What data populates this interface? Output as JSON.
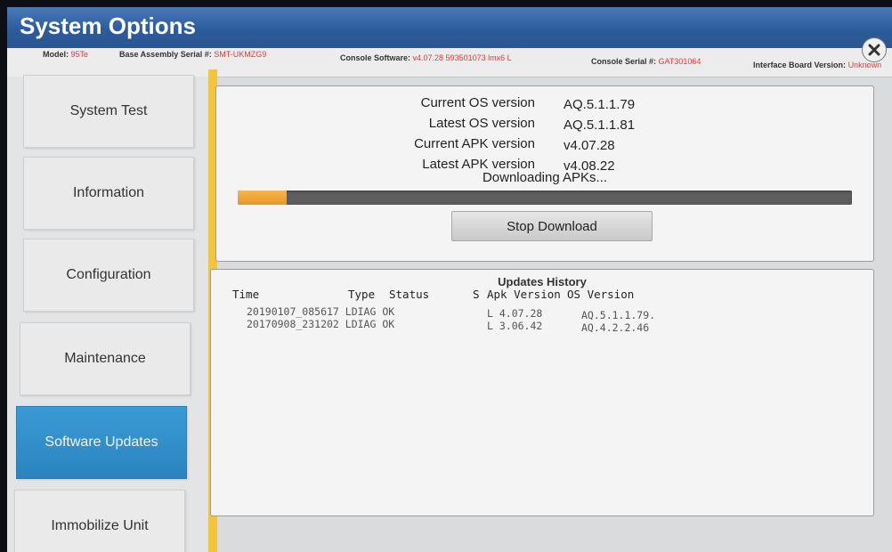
{
  "header": {
    "title": "System Options"
  },
  "info_bar": {
    "model_label": "Model:",
    "model_value": "95Te",
    "base_label": "Base Assembly Serial #:",
    "base_value": "SMT-UKMZG9",
    "console_sw_label": "Console Software:",
    "console_sw_value": "v4.07.28 593501073 lmx6 L",
    "console_serial_label": "Console Serial #:",
    "console_serial_value": "GAT301064",
    "interface_label": "Interface Board Version:",
    "interface_value": "Unknown"
  },
  "sidebar": {
    "items": [
      {
        "label": "System Test"
      },
      {
        "label": "Information"
      },
      {
        "label": "Configuration"
      },
      {
        "label": "Maintenance"
      },
      {
        "label": "Software Updates"
      },
      {
        "label": "Immobilize Unit"
      }
    ],
    "active_index": 4
  },
  "update_panel": {
    "rows": [
      {
        "label": "Current OS version",
        "value": "AQ.5.1.1.79"
      },
      {
        "label": "Latest OS version",
        "value": "AQ.5.1.1.81"
      },
      {
        "label": "Current APK version",
        "value": "v4.07.28"
      },
      {
        "label": "Latest APK version",
        "value": "v4.08.22"
      }
    ],
    "status_text": "Downloading APKs...",
    "progress_fraction": 0.08,
    "stop_button_label": "Stop Download"
  },
  "history": {
    "title": "Updates History",
    "columns": {
      "time": "Time",
      "type": "Type",
      "status": "Status",
      "s": "S",
      "apk": "Apk Version",
      "os": "OS Version"
    },
    "rows": [
      {
        "time_type_status": "20190107_085617 LDIAG OK",
        "s_apk": "L 4.07.28",
        "os": "AQ.5.1.1.79."
      },
      {
        "time_type_status": "20170908_231202 LDIAG OK",
        "s_apk": "L 3.06.42",
        "os": "AQ.4.2.2.46"
      }
    ]
  },
  "colors": {
    "header_blue": "#2d5c9c",
    "active_nav": "#2b84c0",
    "accent_yellow": "#f2c53d",
    "progress_orange": "#e8962a",
    "info_value_red": "#e03b3b"
  },
  "icons": {
    "close": "close-icon"
  }
}
